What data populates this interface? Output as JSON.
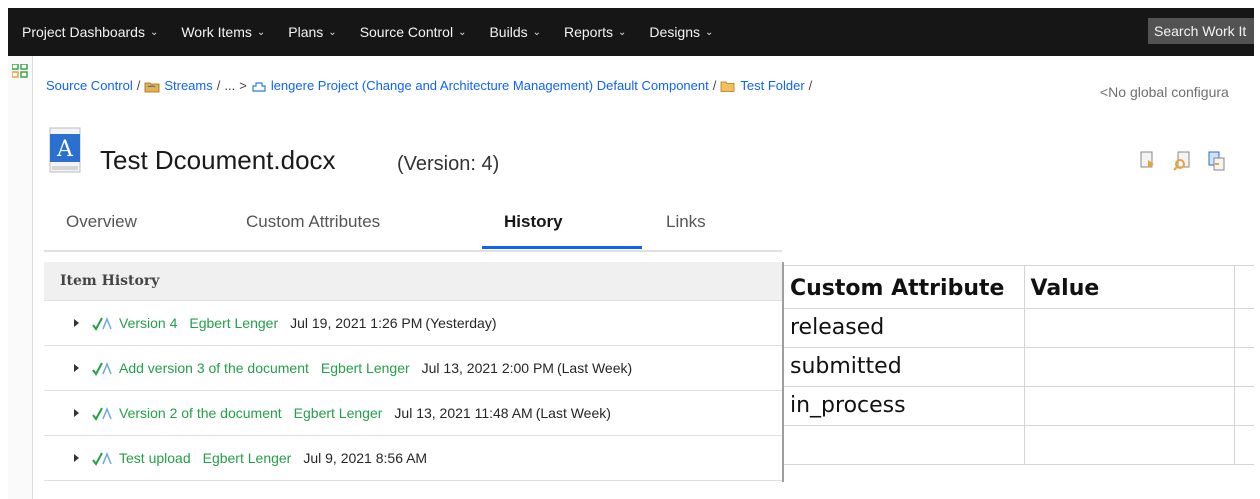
{
  "nav": {
    "items": [
      {
        "label": "Project Dashboards"
      },
      {
        "label": "Work Items"
      },
      {
        "label": "Plans"
      },
      {
        "label": "Source Control"
      },
      {
        "label": "Builds"
      },
      {
        "label": "Reports"
      },
      {
        "label": "Designs"
      }
    ],
    "search_text": "Search Work It"
  },
  "breadcrumb": {
    "source_control": "Source Control",
    "streams": "Streams",
    "ellipsis": "...",
    "component": "lengere Project (Change and Architecture Management) Default Component",
    "folder": "Test Folder",
    "sep": "/"
  },
  "global_config": "<No global configura",
  "document": {
    "title": "Test Dcoument.docx",
    "version": "(Version: 4)"
  },
  "tabs": [
    {
      "label": "Overview"
    },
    {
      "label": "Custom Attributes"
    },
    {
      "label": "History"
    },
    {
      "label": "Links"
    }
  ],
  "history": {
    "header": "Item History",
    "rows": [
      {
        "label": "Version 4",
        "author": "Egbert Lenger",
        "date": "Jul 19, 2021 1:26 PM",
        "relative": "(Yesterday)"
      },
      {
        "label": "Add version 3 of the document",
        "author": "Egbert Lenger",
        "date": "Jul 13, 2021 2:00 PM",
        "relative": "(Last Week)"
      },
      {
        "label": "Version 2 of the document",
        "author": "Egbert Lenger",
        "date": "Jul 13, 2021 11:48 AM",
        "relative": "(Last Week)"
      },
      {
        "label": "Test upload",
        "author": "Egbert Lenger",
        "date": "Jul 9, 2021 8:56 AM",
        "relative": ""
      }
    ]
  },
  "sheet": {
    "headers": [
      "Custom Attribute",
      "Value"
    ],
    "rows": [
      "released",
      "submitted",
      "in_process",
      "",
      ""
    ]
  },
  "colors": {
    "accent": "#0f62fe",
    "link_green": "#24a148",
    "topbar": "#161616"
  }
}
